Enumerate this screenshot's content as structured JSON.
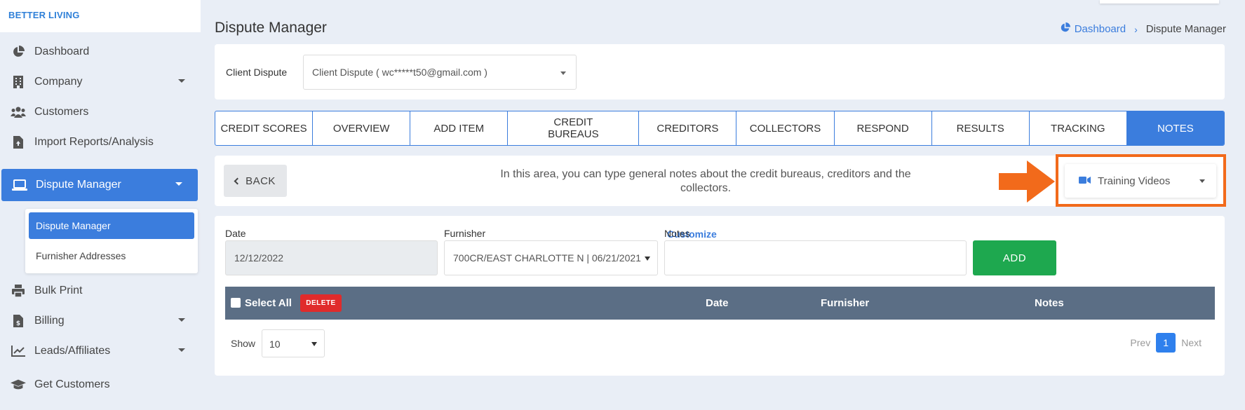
{
  "brand": "BETTER LIVING",
  "sidebar": {
    "items": [
      {
        "label": "Dashboard",
        "icon": "dashboard-pie-icon"
      },
      {
        "label": "Company",
        "icon": "building-icon",
        "has_caret": true
      },
      {
        "label": "Customers",
        "icon": "users-icon"
      },
      {
        "label": "Import Reports/Analysis",
        "icon": "file-upload-icon"
      },
      {
        "label": "Dispute Manager",
        "icon": "laptop-icon",
        "has_caret": true,
        "active": true
      },
      {
        "label": "Bulk Print",
        "icon": "printer-icon"
      },
      {
        "label": "Billing",
        "icon": "invoice-dollar-icon",
        "has_caret": true
      },
      {
        "label": "Leads/Affiliates",
        "icon": "chart-line-icon",
        "has_caret": true
      },
      {
        "label": "Get Customers",
        "icon": "graduation-cap-icon"
      }
    ],
    "submenu": [
      {
        "label": "Dispute Manager",
        "active": true
      },
      {
        "label": "Furnisher Addresses"
      }
    ]
  },
  "header": {
    "title": "Dispute Manager",
    "breadcrumb": {
      "home": "Dashboard",
      "current": "Dispute Manager"
    }
  },
  "client": {
    "label": "Client Dispute",
    "selected": "Client Dispute ( wc*****t50@gmail.com )"
  },
  "tabs": [
    {
      "label": "CREDIT SCORES"
    },
    {
      "label": "OVERVIEW"
    },
    {
      "label": "ADD ITEM"
    },
    {
      "label": "CREDIT BUREAUS"
    },
    {
      "label": "CREDITORS"
    },
    {
      "label": "COLLECTORS"
    },
    {
      "label": "RESPOND"
    },
    {
      "label": "RESULTS"
    },
    {
      "label": "TRACKING"
    },
    {
      "label": "NOTES",
      "active": true
    }
  ],
  "notes_bar": {
    "back_label": "BACK",
    "info": "In this area, you can type general notes about the credit bureaus, creditors and the collectors.",
    "training_label": "Training Videos"
  },
  "form": {
    "date_label": "Date",
    "date_value": "12/12/2022",
    "furnisher_label": "Furnisher",
    "customize_label": "Customize",
    "furnisher_value": "700CR/EAST CHARLOTTE N | 06/21/2021",
    "notes_label": "Notes",
    "notes_value": "",
    "add_label": "ADD"
  },
  "table": {
    "select_all_label": "Select All",
    "delete_label": "DELETE",
    "columns": [
      "Date",
      "Furnisher",
      "Notes"
    ]
  },
  "pagination": {
    "show_label": "Show",
    "page_size": "10",
    "prev_label": "Prev",
    "current_page": "1",
    "next_label": "Next"
  },
  "colors": {
    "primary": "#3b7ddd",
    "success": "#1ea84f",
    "danger": "#e02b2b",
    "highlight": "#f26a1b",
    "table_header": "#5b6e85"
  }
}
